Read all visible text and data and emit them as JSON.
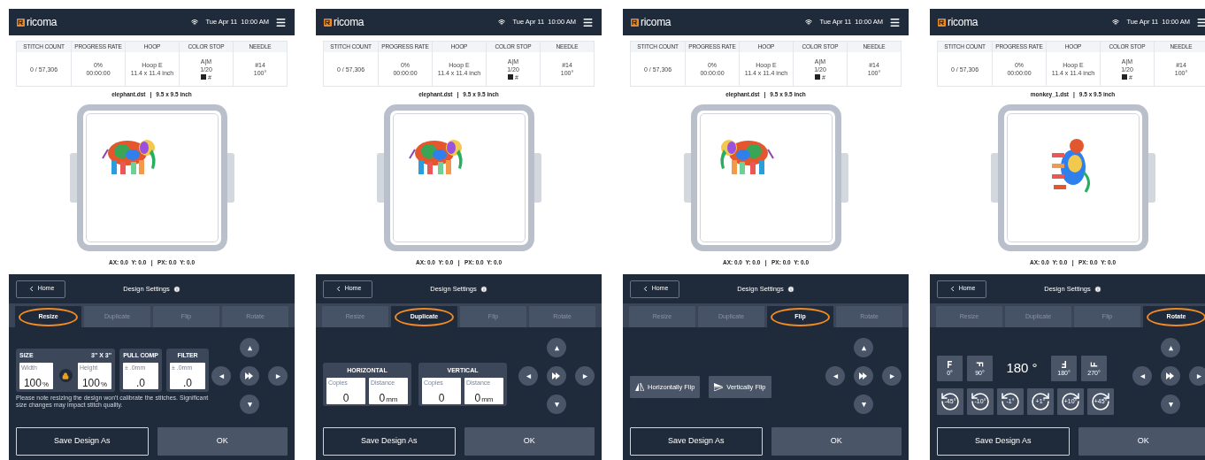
{
  "screens": [
    {
      "header": {
        "logo": "ricoma",
        "date": "Tue Apr 11",
        "time": "10:00 AM"
      },
      "stats": [
        {
          "label": "STITCH COUNT",
          "lines": [
            "0 / 57,306"
          ]
        },
        {
          "label": "PROGRESS RATE",
          "lines": [
            "0%",
            "00:00:00"
          ]
        },
        {
          "label": "HOOP",
          "lines": [
            "Hoop E",
            "11.4 x 11.4 inch"
          ]
        },
        {
          "label": "COLOR STOP",
          "lines": [
            "A|M",
            "1/20"
          ],
          "swatch": {
            "color": "#222222",
            "text": "#"
          }
        },
        {
          "label": "NEEDLE",
          "lines": [
            "#14",
            "100°"
          ]
        }
      ],
      "file": {
        "name": "elephant.dst",
        "separator": "|",
        "size": "9.5 x 9.5 inch"
      },
      "design": {
        "kind": "elephant",
        "mirrored": false
      },
      "coords": "AX: 0.0  Y: 0.0   |   PX: 0.0  Y: 0.0",
      "panel": {
        "back": "Home",
        "title": "Design Settings",
        "tabs": [
          {
            "label": "Resize",
            "selected": true
          },
          {
            "label": "Duplicate",
            "selected": false
          },
          {
            "label": "Flip",
            "selected": false
          },
          {
            "label": "Rotate",
            "selected": false
          }
        ],
        "content": {
          "kind": "resize",
          "size": {
            "label": "SIZE",
            "dims": "3\" X 3\"",
            "locked": true,
            "fields": [
              {
                "label": "Width",
                "value": "100",
                "unit": "%"
              },
              {
                "label": "Height",
                "value": "100",
                "unit": "%"
              }
            ]
          },
          "extras": [
            {
              "label": "PULL COMP",
              "hint": "± .0mm",
              "value": ".0"
            },
            {
              "label": "FILTER",
              "hint": "± .0mm",
              "value": ".0"
            }
          ],
          "note": "Please note resizing the design won't calibrate the stitches. Significant size changes may impact stitch quality."
        },
        "save": "Save Design As",
        "ok": "OK"
      }
    },
    {
      "header": {
        "logo": "ricoma",
        "date": "Tue Apr 11",
        "time": "10:00 AM"
      },
      "stats": [
        {
          "label": "STITCH COUNT",
          "lines": [
            "0 / 57,306"
          ]
        },
        {
          "label": "PROGRESS RATE",
          "lines": [
            "0%",
            "00:00:00"
          ]
        },
        {
          "label": "HOOP",
          "lines": [
            "Hoop E",
            "11.4 x 11.4 inch"
          ]
        },
        {
          "label": "COLOR STOP",
          "lines": [
            "A|M",
            "1/20"
          ],
          "swatch": {
            "color": "#222222",
            "text": "#"
          }
        },
        {
          "label": "NEEDLE",
          "lines": [
            "#14",
            "100°"
          ]
        }
      ],
      "file": {
        "name": "elephant.dst",
        "separator": "|",
        "size": "9.5 x 9.5 inch"
      },
      "design": {
        "kind": "elephant",
        "mirrored": false
      },
      "coords": "AX: 0.0  Y: 0.0   |   PX: 0.0  Y: 0.0",
      "panel": {
        "back": "Home",
        "title": "Design Settings",
        "tabs": [
          {
            "label": "Resize",
            "selected": false
          },
          {
            "label": "Duplicate",
            "selected": true
          },
          {
            "label": "Flip",
            "selected": false
          },
          {
            "label": "Rotate",
            "selected": false
          }
        ],
        "content": {
          "kind": "duplicate",
          "groups": [
            {
              "label": "HORIZONTAL",
              "fields": [
                {
                  "label": "Copies",
                  "value": "0"
                },
                {
                  "label": "Distance",
                  "value": "0",
                  "unit": "mm"
                }
              ]
            },
            {
              "label": "VERTICAL",
              "fields": [
                {
                  "label": "Copies",
                  "value": "0"
                },
                {
                  "label": "Distance",
                  "value": "0",
                  "unit": "mm"
                }
              ]
            }
          ]
        },
        "save": "Save Design As",
        "ok": "OK"
      }
    },
    {
      "header": {
        "logo": "ricoma",
        "date": "Tue Apr 11",
        "time": "10:00 AM"
      },
      "stats": [
        {
          "label": "STITCH COUNT",
          "lines": [
            "0 / 57,306"
          ]
        },
        {
          "label": "PROGRESS RATE",
          "lines": [
            "0%",
            "00:00:00"
          ]
        },
        {
          "label": "HOOP",
          "lines": [
            "Hoop E",
            "11.4 x 11.4 inch"
          ]
        },
        {
          "label": "COLOR STOP",
          "lines": [
            "A|M",
            "1/20"
          ],
          "swatch": {
            "color": "#222222",
            "text": "#"
          }
        },
        {
          "label": "NEEDLE",
          "lines": [
            "#14",
            "100°"
          ]
        }
      ],
      "file": {
        "name": "elephant.dst",
        "separator": "|",
        "size": "9.5 x 9.5 inch"
      },
      "design": {
        "kind": "elephant",
        "mirrored": true
      },
      "coords": "AX: 0.0  Y: 0.0   |   PX: 0.0  Y: 0.0",
      "panel": {
        "back": "Home",
        "title": "Design Settings",
        "tabs": [
          {
            "label": "Resize",
            "selected": false
          },
          {
            "label": "Duplicate",
            "selected": false
          },
          {
            "label": "Flip",
            "selected": true
          },
          {
            "label": "Rotate",
            "selected": false
          }
        ],
        "content": {
          "kind": "flip",
          "buttons": [
            {
              "kind": "horizontal",
              "label": "Horizontally Flip"
            },
            {
              "kind": "vertical",
              "label": "Vertically Flip"
            }
          ]
        },
        "save": "Save Design As",
        "ok": "OK"
      }
    },
    {
      "header": {
        "logo": "ricoma",
        "date": "Tue Apr 11",
        "time": "10:00 AM"
      },
      "stats": [
        {
          "label": "STITCH COUNT",
          "lines": [
            "0 / 57,306"
          ]
        },
        {
          "label": "PROGRESS RATE",
          "lines": [
            "0%",
            "00:00:00"
          ]
        },
        {
          "label": "HOOP",
          "lines": [
            "Hoop E",
            "11.4 x 11.4 inch"
          ]
        },
        {
          "label": "COLOR STOP",
          "lines": [
            "A|M",
            "1/20"
          ],
          "swatch": {
            "color": "#222222",
            "text": "#"
          }
        },
        {
          "label": "NEEDLE",
          "lines": [
            "#14",
            "100°"
          ]
        }
      ],
      "file": {
        "name": "monkey_1.dst",
        "separator": "|",
        "size": "9.5 x 9.5 inch"
      },
      "design": {
        "kind": "monkey",
        "mirrored": false
      },
      "coords": "AX: 0.0  Y: 0.0   |   PX: 0.0  Y: 0.0",
      "panel": {
        "back": "Home",
        "title": "Design Settings",
        "tabs": [
          {
            "label": "Resize",
            "selected": false
          },
          {
            "label": "Duplicate",
            "selected": false
          },
          {
            "label": "Flip",
            "selected": false
          },
          {
            "label": "Rotate",
            "selected": true
          }
        ],
        "content": {
          "kind": "rotate",
          "angle": "180 °",
          "presets": [
            {
              "kind": "up",
              "label": "0°"
            },
            {
              "kind": "right",
              "label": "90°"
            },
            {
              "kind": "down",
              "label": "180°"
            },
            {
              "kind": "left",
              "label": "270°"
            }
          ],
          "steps": [
            {
              "kind": "ccw",
              "label": "-45°"
            },
            {
              "kind": "ccw",
              "label": "-10°"
            },
            {
              "kind": "ccw",
              "label": "-1°"
            },
            {
              "kind": "cw",
              "label": "+1°"
            },
            {
              "kind": "cw",
              "label": "+10°"
            },
            {
              "kind": "cw",
              "label": "+45°"
            }
          ]
        },
        "save": "Save Design As",
        "ok": "OK"
      }
    }
  ]
}
